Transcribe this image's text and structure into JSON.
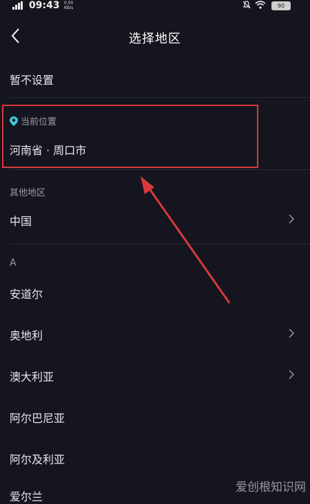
{
  "status_bar": {
    "time": "09:43",
    "net_speed_value": "0.00",
    "net_speed_unit": "KB/s",
    "battery": "90"
  },
  "header": {
    "title": "选择地区"
  },
  "options": {
    "not_set": "暂不设置"
  },
  "current": {
    "label": "当前位置",
    "location": "河南省 · 周口市"
  },
  "other_regions": {
    "label": "其他地区",
    "country": "中国"
  },
  "section": {
    "letter": "A",
    "items": [
      {
        "label": "安道尔"
      },
      {
        "label": "奥地利"
      },
      {
        "label": "澳大利亚"
      },
      {
        "label": "阿尔巴尼亚"
      },
      {
        "label": "阿尔及利亚"
      },
      {
        "label": "爱尔兰"
      }
    ]
  },
  "watermark": "爱创根知识网",
  "colors": {
    "background": "#15151f",
    "highlight": "#d9393d",
    "accent": "#3fc6d6"
  }
}
